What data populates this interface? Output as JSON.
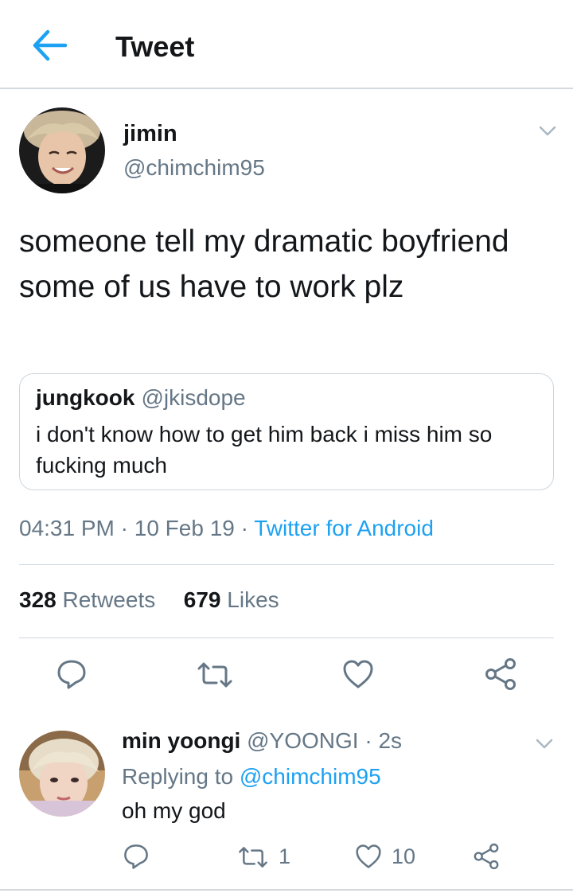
{
  "header": {
    "title": "Tweet",
    "back_icon": "arrow-left-icon"
  },
  "tweet": {
    "author_name": "jimin",
    "author_handle": "@chimchim95",
    "text": "someone tell my dramatic boyfriend some of us have to work plz",
    "quote": {
      "author_name": "jungkook",
      "author_handle": "@jkisdope",
      "text": "i don't know how to get him back i miss him so fucking much"
    },
    "time": "04:31 PM",
    "date": "10 Feb 19",
    "separator": "·",
    "source": "Twitter for Android",
    "retweets_count": "328",
    "retweets_label": "Retweets",
    "likes_count": "679",
    "likes_label": "Likes"
  },
  "reply": {
    "author_name": "min yoongi",
    "author_handle": "@YOONGI",
    "dot": "·",
    "time": "2s",
    "replying_prefix": "Replying to",
    "replying_to": "@chimchim95",
    "text": "oh my god",
    "retweets_count": "1",
    "likes_count": "10"
  },
  "colors": {
    "accent": "#1da1f2",
    "secondary_text": "#657786",
    "divider": "#ccd6dd",
    "primary_text": "#14171a"
  },
  "icons": [
    "arrow-left-icon",
    "chevron-down-icon",
    "reply-icon",
    "retweet-icon",
    "heart-icon",
    "share-icon"
  ]
}
